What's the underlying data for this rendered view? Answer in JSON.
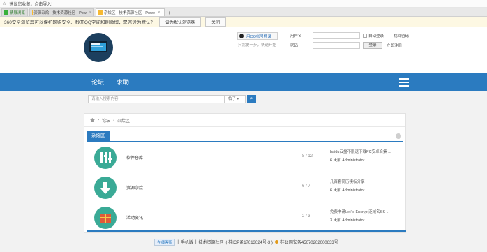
{
  "browser": {
    "notice": "建议您收藏，点击导入!",
    "tabs": [
      {
        "label": "猜展浏览",
        "active": false
      },
      {
        "label": "资源杂烩 - 技术资源社区 - Pow",
        "active": false
      },
      {
        "label": "杂烩区 - 技术资源社区 - Powe",
        "active": true
      }
    ],
    "new_tab": "+",
    "infobar": {
      "text": "360安全浏览器可以保护网购安全、秒开QQ空间和刷微博，是否设为默认？",
      "set_default": "设为默认浏览器",
      "close": "关闭"
    }
  },
  "header": {
    "qq_login": "用QQ帐号登录",
    "qq_tip": "只需要一步，快速开始",
    "username_label": "用户名",
    "password_label": "密码",
    "auto_login": "自动登录",
    "forgot": "找回密码",
    "login_btn": "登录",
    "register": "立即注册"
  },
  "nav": {
    "items": [
      "论坛",
      "求助"
    ]
  },
  "search": {
    "placeholder": "请输入搜索内容",
    "type": "帖子"
  },
  "crumbs": [
    "论坛",
    "杂烩区"
  ],
  "section": {
    "title": "杂烩区"
  },
  "forums": [
    {
      "name": "软件仓库",
      "count": "8 / 12",
      "last_title": "baidu云盘不限速下载PC安卓合集 ...",
      "last_meta": "6 天前 Administrator"
    },
    {
      "name": "资源杂烩",
      "count": "6 / 7",
      "last_title": "几百套简历模板分享",
      "last_meta": "6 天前 Administrator"
    },
    {
      "name": "活动资讯",
      "count": "2 / 3",
      "last_title": "免费申请Let' s Encrypt泛域名SS ...",
      "last_meta": "3 天前 Administrator"
    }
  ],
  "footer": {
    "online": "在线客服",
    "mobile": "手机版",
    "site": "技术资源社区",
    "icp": "( 桂ICP备17013024号-3 )",
    "police": "桂公网安备45070202000633号"
  }
}
